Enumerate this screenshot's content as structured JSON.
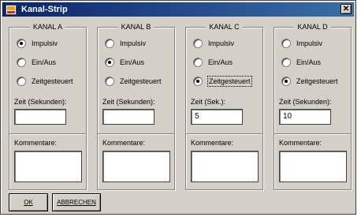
{
  "window": {
    "title": "Kanal-Strip",
    "close_glyph": "✕"
  },
  "groups": [
    {
      "title": "KANAL A",
      "options": [
        {
          "label": "Impulsiv",
          "checked": true,
          "focused": false
        },
        {
          "label": "Ein/Aus",
          "checked": false,
          "focused": false
        },
        {
          "label": "Zeitgesteuert",
          "checked": false,
          "focused": false
        }
      ],
      "time_label": "Zeit (Sekunden):",
      "time_value": "",
      "comment_label": "Kommentare:"
    },
    {
      "title": "KANAL B",
      "options": [
        {
          "label": "Impulsiv",
          "checked": false,
          "focused": false
        },
        {
          "label": "Ein/Aus",
          "checked": true,
          "focused": false
        },
        {
          "label": "Zeitgesteuert",
          "checked": false,
          "focused": false
        }
      ],
      "time_label": "Zeit (Sekunden):",
      "time_value": "",
      "comment_label": "Kommentare:"
    },
    {
      "title": "KANAL C",
      "options": [
        {
          "label": "Impulsiv",
          "checked": false,
          "focused": false
        },
        {
          "label": "Ein/Aus",
          "checked": false,
          "focused": false
        },
        {
          "label": "Zeitgesteuert",
          "checked": true,
          "focused": true
        }
      ],
      "time_label": "Zeit (Sek.):",
      "time_value": "5",
      "comment_label": "Kommentare:"
    },
    {
      "title": "KANAL D",
      "options": [
        {
          "label": "Impulsiv",
          "checked": false,
          "focused": false
        },
        {
          "label": "Ein/Aus",
          "checked": false,
          "focused": false
        },
        {
          "label": "Zeitgesteuert",
          "checked": true,
          "focused": false
        }
      ],
      "time_label": "Zeit (Sekunden):",
      "time_value": "10",
      "comment_label": "Kommentare:"
    }
  ],
  "buttons": {
    "ok": "OK",
    "cancel": "ABBRECHEN"
  }
}
